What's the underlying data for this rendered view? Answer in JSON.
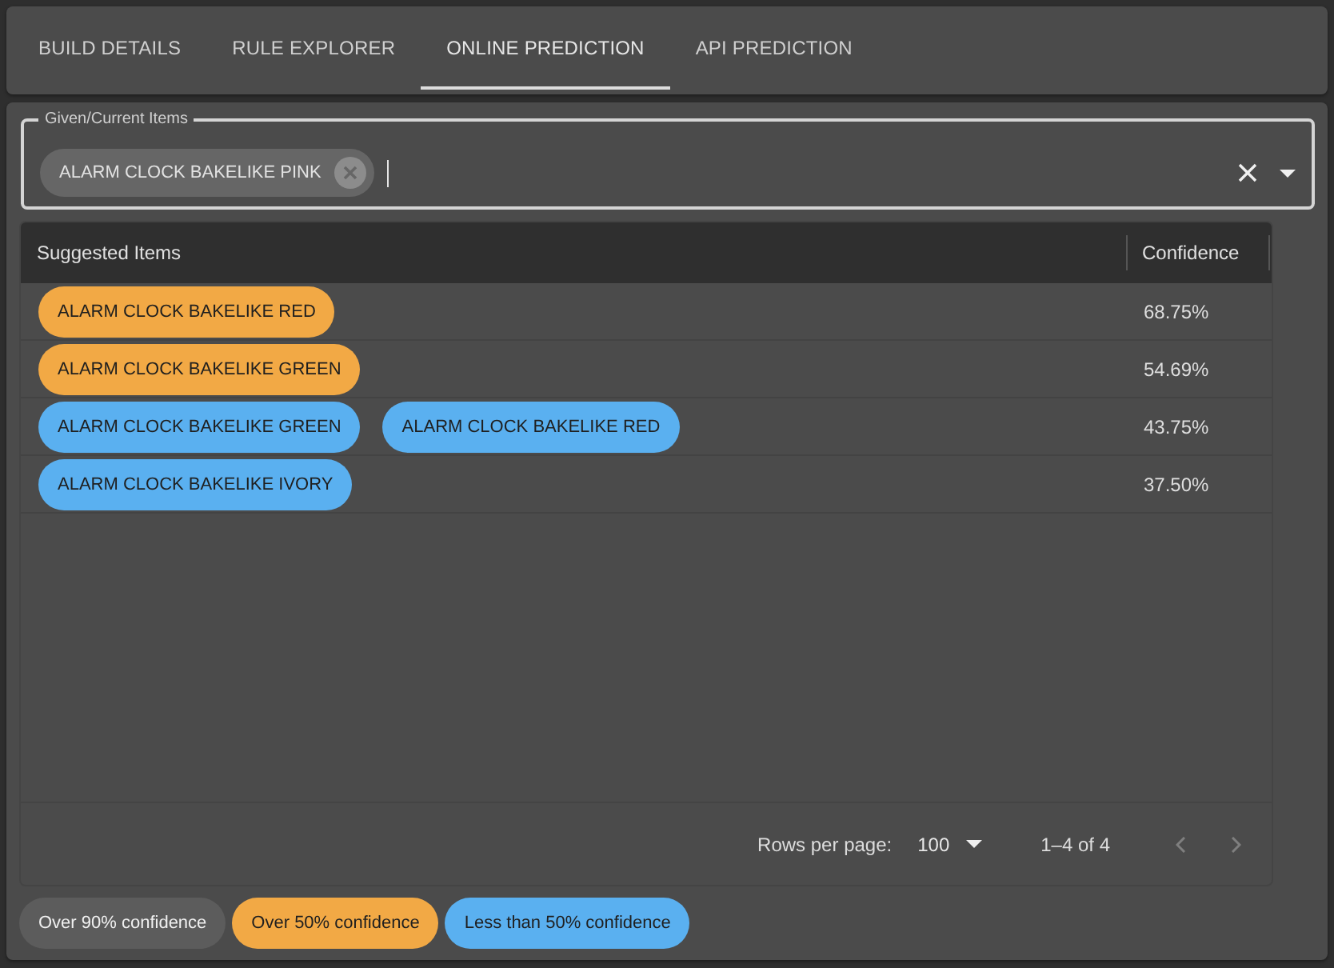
{
  "tabs": [
    {
      "label": "BUILD DETAILS",
      "selected": false
    },
    {
      "label": "RULE EXPLORER",
      "selected": false
    },
    {
      "label": "ONLINE PREDICTION",
      "selected": true
    },
    {
      "label": "API PREDICTION",
      "selected": false
    }
  ],
  "given_items": {
    "label": "Given/Current Items",
    "chips": [
      {
        "label": "ALARM CLOCK BAKELIKE PINK"
      }
    ]
  },
  "table": {
    "columns": [
      "Suggested Items",
      "Confidence"
    ],
    "rows": [
      {
        "items": [
          {
            "label": "ALARM CLOCK BAKELIKE RED",
            "color": "#f2a945"
          }
        ],
        "confidence": "68.75%"
      },
      {
        "items": [
          {
            "label": "ALARM CLOCK BAKELIKE GREEN",
            "color": "#f2a945"
          }
        ],
        "confidence": "54.69%"
      },
      {
        "items": [
          {
            "label": "ALARM CLOCK BAKELIKE GREEN",
            "color": "#5ab0f0"
          },
          {
            "label": "ALARM CLOCK BAKELIKE RED",
            "color": "#5ab0f0"
          }
        ],
        "confidence": "43.75%"
      },
      {
        "items": [
          {
            "label": "ALARM CLOCK BAKELIKE IVORY",
            "color": "#5ab0f0"
          }
        ],
        "confidence": "37.50%"
      }
    ]
  },
  "pagination": {
    "rows_per_page_label": "Rows per page:",
    "rows_per_page": "100",
    "range": "1–4 of 4",
    "previous": {
      "disabled": true
    },
    "next": {
      "disabled": true
    }
  },
  "legend": [
    {
      "label": "Over 90% confidence",
      "color": "#5c5c5c"
    },
    {
      "label": "Over 50% confidence",
      "color": "#f2a945"
    },
    {
      "label": "Less than 50% confidence",
      "color": "#5ab0f0"
    }
  ]
}
